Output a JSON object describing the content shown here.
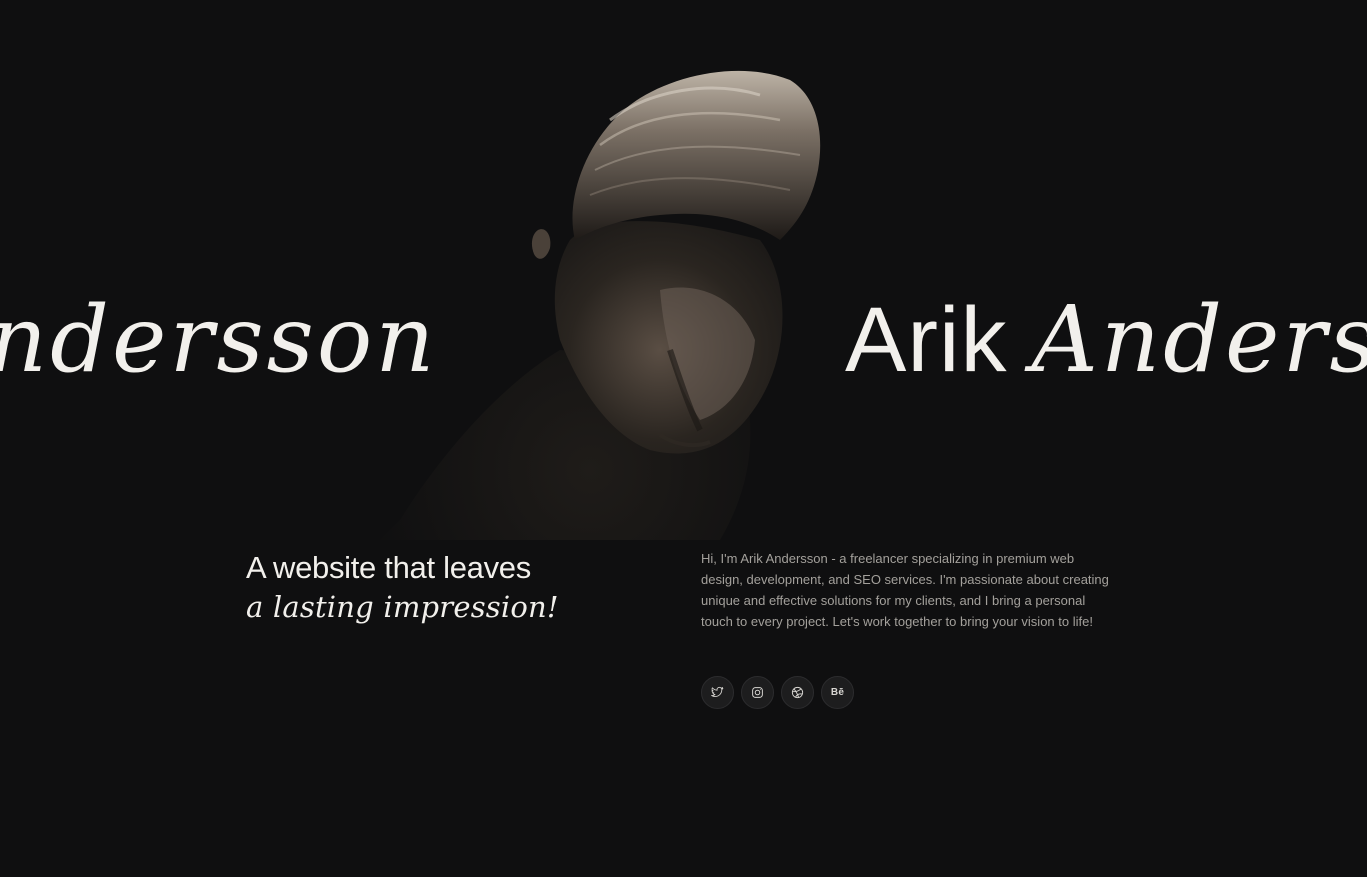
{
  "hero": {
    "name_first": "Arik",
    "name_last": "Andersson",
    "name_first_partial": "k"
  },
  "tagline": {
    "line1": "A website that leaves",
    "line2": "a lasting impression!"
  },
  "intro": {
    "text": "Hi, I'm Arik Andersson - a freelancer specializing in premium web design, development, and SEO services. I'm passionate about creating unique and effective solutions for my clients, and I bring a personal touch to every project. Let's work together to bring your vision to life!"
  },
  "socials": [
    {
      "icon": "twitter-icon"
    },
    {
      "icon": "instagram-icon"
    },
    {
      "icon": "dribbble-icon"
    },
    {
      "icon": "behance-icon",
      "label": "Bē"
    }
  ],
  "colors": {
    "background": "#0f0f10",
    "text": "#f2f0ec",
    "muted": "#a3a09b",
    "button": "#1d1d1e"
  }
}
